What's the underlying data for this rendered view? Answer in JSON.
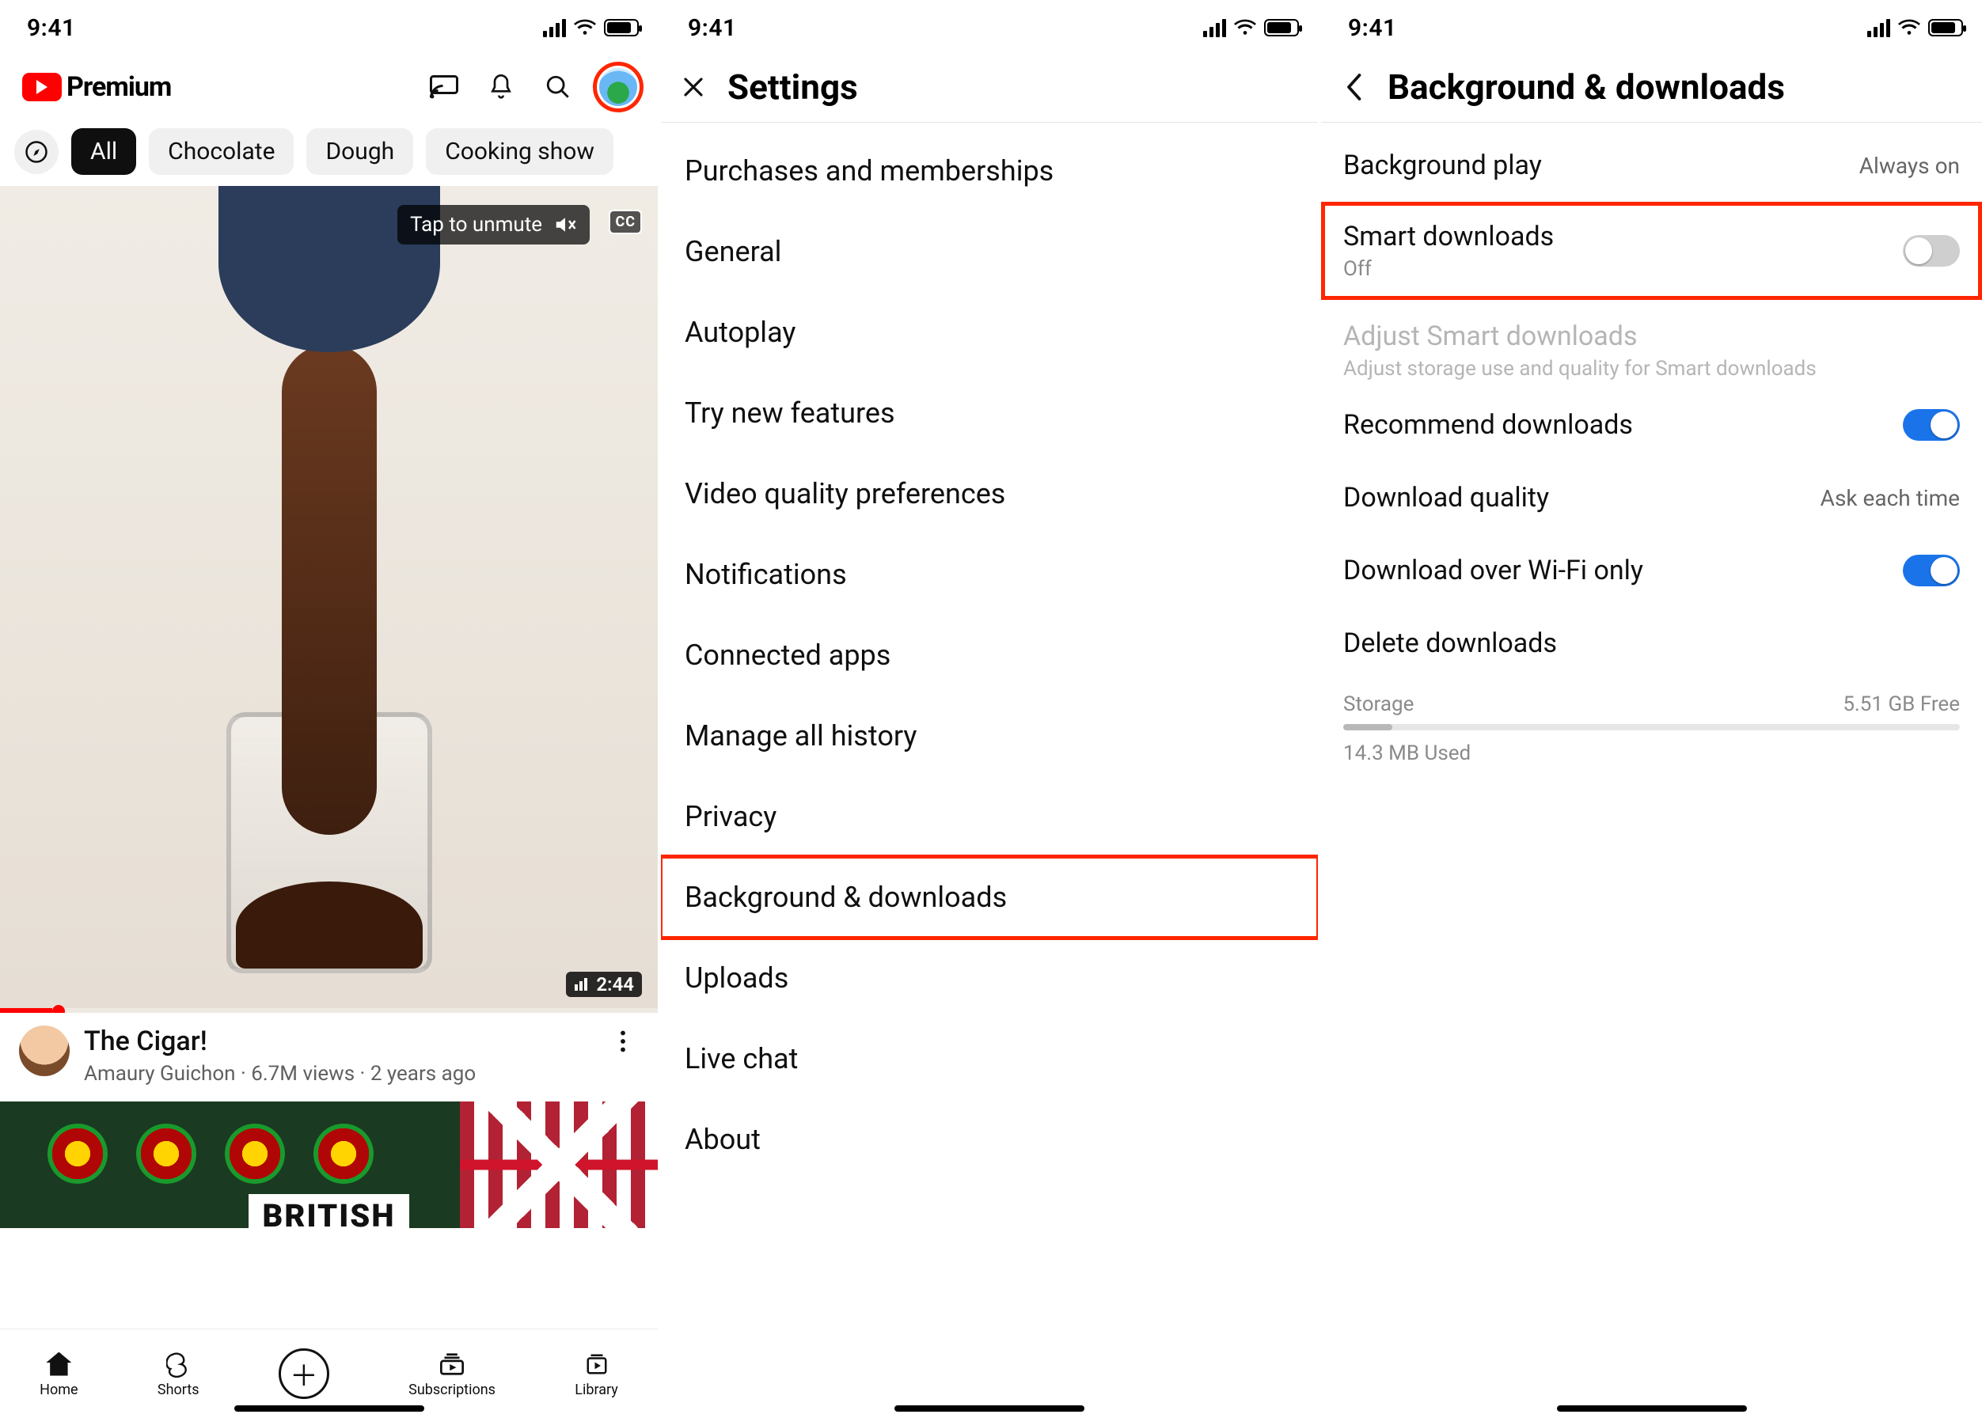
{
  "status": {
    "time": "9:41"
  },
  "a": {
    "brand": "Premium",
    "chips": {
      "all": "All",
      "c1": "Chocolate",
      "c2": "Dough",
      "c3": "Cooking show"
    },
    "player": {
      "unmute": "Tap to unmute",
      "cc": "CC",
      "duration": "2:44"
    },
    "video": {
      "title": "The Cigar!",
      "channel": "Amaury Guichon",
      "views": "6.7M views",
      "age": "2 years ago"
    },
    "second_thumb_text": "BRITISH",
    "tabs": {
      "home": "Home",
      "shorts": "Shorts",
      "subs": "Subscriptions",
      "library": "Library"
    }
  },
  "b": {
    "title": "Settings",
    "items": [
      "Purchases and memberships",
      "General",
      "Autoplay",
      "Try new features",
      "Video quality preferences",
      "Notifications",
      "Connected apps",
      "Manage all history",
      "Privacy",
      "Background & downloads",
      "Uploads",
      "Live chat",
      "About"
    ]
  },
  "c": {
    "title": "Background & downloads",
    "background_play": {
      "label": "Background play",
      "value": "Always on"
    },
    "smart_downloads": {
      "label": "Smart downloads",
      "state": "Off"
    },
    "adjust": {
      "label": "Adjust Smart downloads",
      "sub": "Adjust storage use and quality for Smart downloads"
    },
    "recommend": {
      "label": "Recommend downloads"
    },
    "quality": {
      "label": "Download quality",
      "value": "Ask each time"
    },
    "wifi": {
      "label": "Download over Wi-Fi only"
    },
    "delete": {
      "label": "Delete downloads"
    },
    "storage": {
      "label": "Storage",
      "free": "5.51 GB Free",
      "used": "14.3 MB Used"
    }
  }
}
